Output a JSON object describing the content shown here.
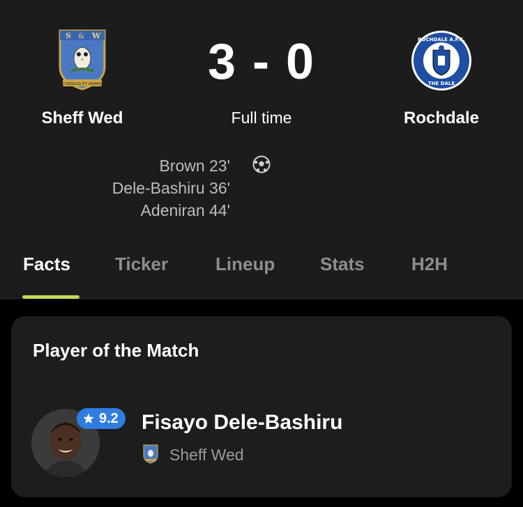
{
  "match": {
    "home_team": "Sheff Wed",
    "away_team": "Rochdale",
    "score": "3 - 0",
    "status": "Full time",
    "home_crest_icon": "sheffield-wednesday-crest-icon",
    "away_crest_icon": "rochdale-crest-icon",
    "away_crest_text_top": "ROCHDALE A.F.C.",
    "away_crest_text_bottom": "THE DALE",
    "home_crest_motto": "CONSILIO ET ANIMIS"
  },
  "scorers": [
    {
      "text": "Brown 23'"
    },
    {
      "text": "Dele-Bashiru 36'"
    },
    {
      "text": "Adeniran 44'"
    }
  ],
  "goal_icon": "football-icon",
  "tabs": [
    {
      "label": "Facts",
      "active": true
    },
    {
      "label": "Ticker",
      "active": false
    },
    {
      "label": "Lineup",
      "active": false
    },
    {
      "label": "Stats",
      "active": false
    },
    {
      "label": "H2H",
      "active": false
    }
  ],
  "player_of_match": {
    "title": "Player of the Match",
    "rating": "9.2",
    "rating_icon": "star-icon",
    "player_name": "Fisayo Dele-Bashiru",
    "team": "Sheff Wed"
  },
  "colors": {
    "background": "#000000",
    "header_bg": "#1c1c1c",
    "card_bg": "#1d1d1d",
    "tab_indicator": "#c6d95c",
    "rating_badge": "#2f7de0",
    "inactive_tab": "#8e8e8e",
    "secondary_text": "#9a9a9a"
  }
}
